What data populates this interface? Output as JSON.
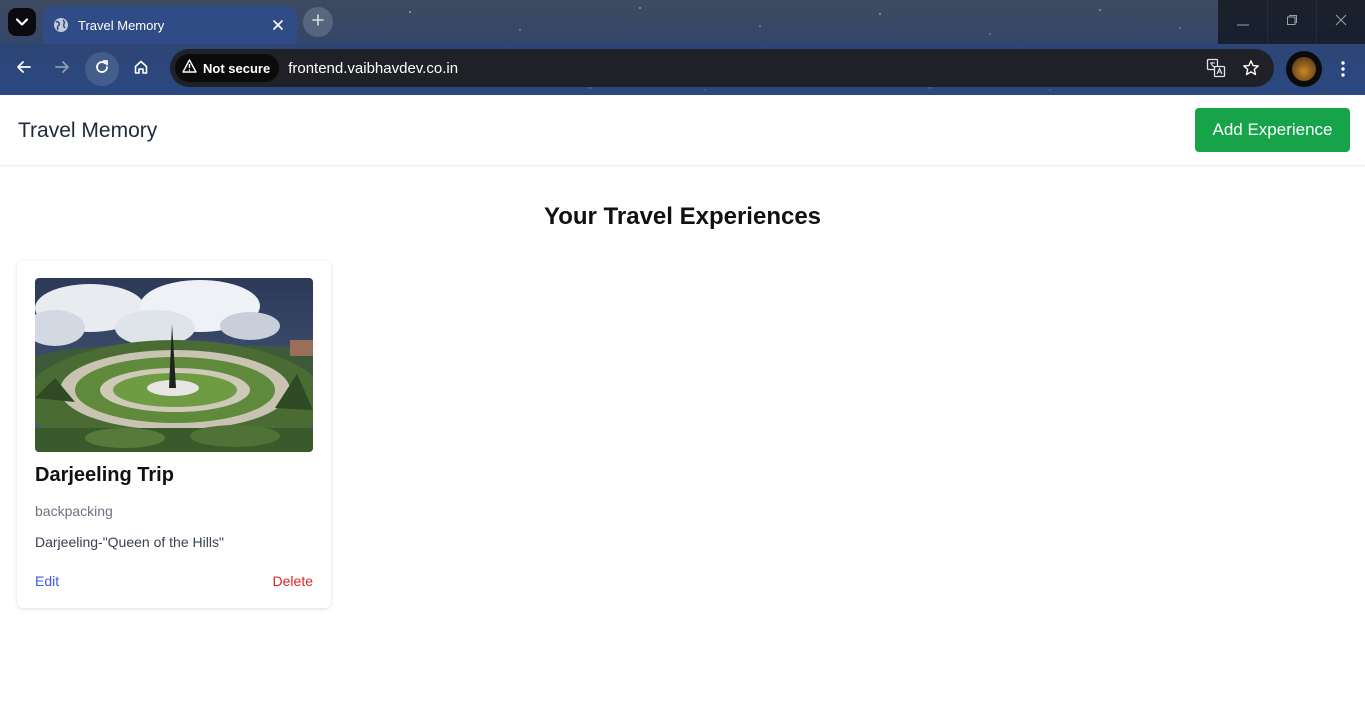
{
  "browser": {
    "tab_title": "Travel Memory",
    "security_label": "Not secure",
    "url": "frontend.vaibhavdev.co.in"
  },
  "header": {
    "brand": "Travel Memory",
    "add_button": "Add Experience"
  },
  "main": {
    "heading": "Your Travel Experiences",
    "experiences": [
      {
        "title": "Darjeeling Trip",
        "trip_type": "backpacking",
        "description": "Darjeeling-\"Queen of the Hills\"",
        "edit_label": "Edit",
        "delete_label": "Delete"
      }
    ]
  },
  "colors": {
    "accent_green": "#16a34a",
    "link_blue": "#3b5bdb",
    "delete_red": "#dc2626"
  },
  "icons": [
    "tab-search-icon",
    "globe-icon",
    "close-icon",
    "plus-icon",
    "minimize-icon",
    "restore-icon",
    "window-close-icon",
    "back-icon",
    "forward-icon",
    "reload-icon",
    "home-icon",
    "warning-icon",
    "translate-icon",
    "star-icon",
    "kebab-menu-icon"
  ]
}
